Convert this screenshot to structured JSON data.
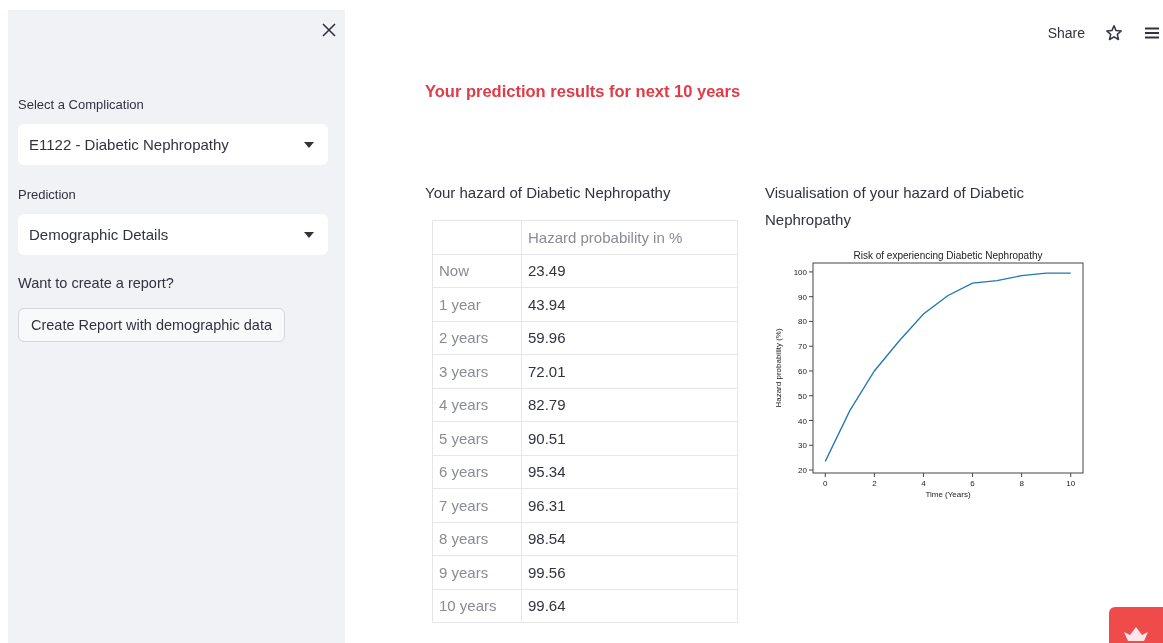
{
  "sidebar": {
    "fields": [
      {
        "label": "Select a Complication",
        "value": "E1122 - Diabetic Nephropathy"
      },
      {
        "label": "Prediction",
        "value": "Demographic Details"
      }
    ],
    "report_prompt": "Want to create a report?",
    "report_button": "Create Report with demographic data"
  },
  "header": {
    "share": "Share"
  },
  "title": "Your prediction results for next 10 years",
  "table": {
    "heading": "Your hazard of Diabetic Nephropathy",
    "columns": [
      "Hazard probability in %"
    ],
    "rows": [
      {
        "index": "Now",
        "value": "23.49"
      },
      {
        "index": "1 year",
        "value": "43.94"
      },
      {
        "index": "2 years",
        "value": "59.96"
      },
      {
        "index": "3 years",
        "value": "72.01"
      },
      {
        "index": "4 years",
        "value": "82.79"
      },
      {
        "index": "5 years",
        "value": "90.51"
      },
      {
        "index": "6 years",
        "value": "95.34"
      },
      {
        "index": "7 years",
        "value": "96.31"
      },
      {
        "index": "8 years",
        "value": "98.54"
      },
      {
        "index": "9 years",
        "value": "99.56"
      },
      {
        "index": "10 years",
        "value": "99.64"
      }
    ]
  },
  "chart": {
    "heading": "Visualisation of your hazard of Diabetic Nephropathy",
    "chart_data": {
      "type": "line",
      "title": "Risk of experiencing Diabetic Nephropathy",
      "xlabel": "Time (Years)",
      "ylabel": "Hazard probability (%)",
      "x": [
        0,
        1,
        2,
        3,
        4,
        5,
        6,
        7,
        8,
        9,
        10
      ],
      "series": [
        {
          "color": "#1f77b4",
          "values": [
            23.5,
            44,
            60,
            72,
            83,
            90.5,
            95.5,
            96.5,
            98.5,
            99.5,
            99.5
          ]
        }
      ],
      "xlim": [
        -0.5,
        10.5
      ],
      "ylim": [
        18.8,
        103.6
      ],
      "xticks": [
        0,
        2,
        4,
        6,
        8,
        10
      ],
      "yticks": [
        20,
        30,
        40,
        50,
        60,
        70,
        80,
        90,
        100
      ]
    }
  }
}
